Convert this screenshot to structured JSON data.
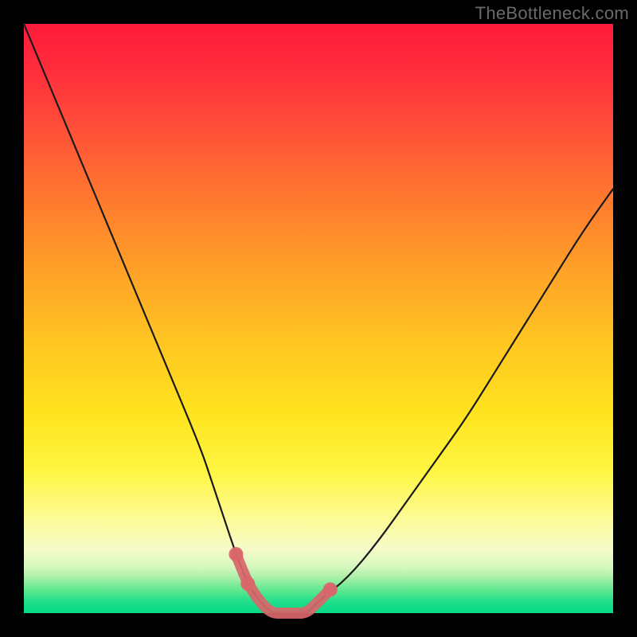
{
  "watermark": "TheBottleneck.com",
  "colors": {
    "frame": "#000000",
    "gradient_top": "#ff1a3a",
    "gradient_bottom": "#04d986",
    "curve": "#1a1a1a",
    "emphasis": "#d9666a"
  },
  "chart_data": {
    "type": "line",
    "title": "",
    "xlabel": "",
    "ylabel": "",
    "xlim": [
      0,
      100
    ],
    "ylim": [
      0,
      100
    ],
    "grid": false,
    "x": [
      0,
      5,
      10,
      15,
      20,
      25,
      30,
      32,
      34,
      36,
      38,
      40,
      42,
      44,
      46,
      48,
      50,
      55,
      60,
      65,
      70,
      75,
      80,
      85,
      90,
      95,
      100
    ],
    "y": [
      100,
      88,
      76,
      64,
      52,
      40,
      28,
      22,
      16,
      10,
      5,
      2,
      0,
      0,
      0,
      0,
      2,
      6,
      12,
      19,
      26,
      33,
      41,
      49,
      57,
      65,
      72
    ],
    "emphasis_region": {
      "x": [
        36,
        38,
        40,
        42,
        44,
        46,
        48,
        50,
        52
      ],
      "y": [
        10,
        5,
        2,
        0,
        0,
        0,
        0,
        2,
        4
      ]
    },
    "emphasis_dots": {
      "x": [
        36,
        38,
        52
      ],
      "y": [
        10,
        5,
        4
      ]
    }
  }
}
